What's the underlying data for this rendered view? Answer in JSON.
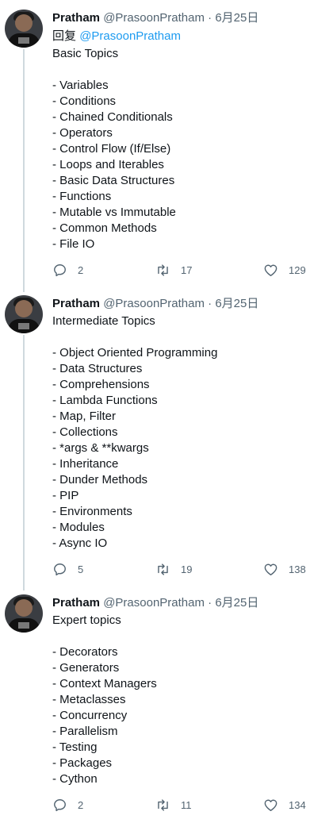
{
  "tweets": [
    {
      "name": "Pratham",
      "handle": "@PrasoonPratham",
      "date": "6月25日",
      "reply_prefix": "回复",
      "reply_mention": "@PrasoonPratham",
      "lines": [
        "Basic Topics",
        "",
        "- Variables",
        "- Conditions",
        "- Chained Conditionals",
        "- Operators",
        "- Control Flow (If/Else)",
        "- Loops and Iterables",
        "- Basic Data Structures",
        "- Functions",
        "- Mutable vs Immutable",
        "- Common Methods",
        "- File IO"
      ],
      "replies": "2",
      "retweets": "17",
      "likes": "129"
    },
    {
      "name": "Pratham",
      "handle": "@PrasoonPratham",
      "date": "6月25日",
      "lines": [
        "Intermediate Topics",
        "",
        "- Object Oriented Programming",
        "- Data Structures",
        "- Comprehensions",
        "- Lambda Functions",
        "- Map, Filter",
        "- Collections",
        "- *args & **kwargs",
        "- Inheritance",
        "- Dunder Methods",
        "- PIP",
        "- Environments",
        "- Modules",
        "- Async IO"
      ],
      "replies": "5",
      "retweets": "19",
      "likes": "138"
    },
    {
      "name": "Pratham",
      "handle": "@PrasoonPratham",
      "date": "6月25日",
      "lines": [
        "Expert topics",
        "",
        "- Decorators",
        "- Generators",
        "- Context Managers",
        "- Metaclasses",
        "- Concurrency",
        "- Parallelism",
        "- Testing",
        "- Packages",
        "- Cython"
      ],
      "replies": "2",
      "retweets": "11",
      "likes": "134"
    }
  ],
  "icons": {
    "reply": "reply-icon",
    "retweet": "retweet-icon",
    "like": "heart-icon"
  },
  "colors": {
    "link": "#1d9bf0",
    "secondary": "#536471",
    "thread": "#cfd9de"
  }
}
